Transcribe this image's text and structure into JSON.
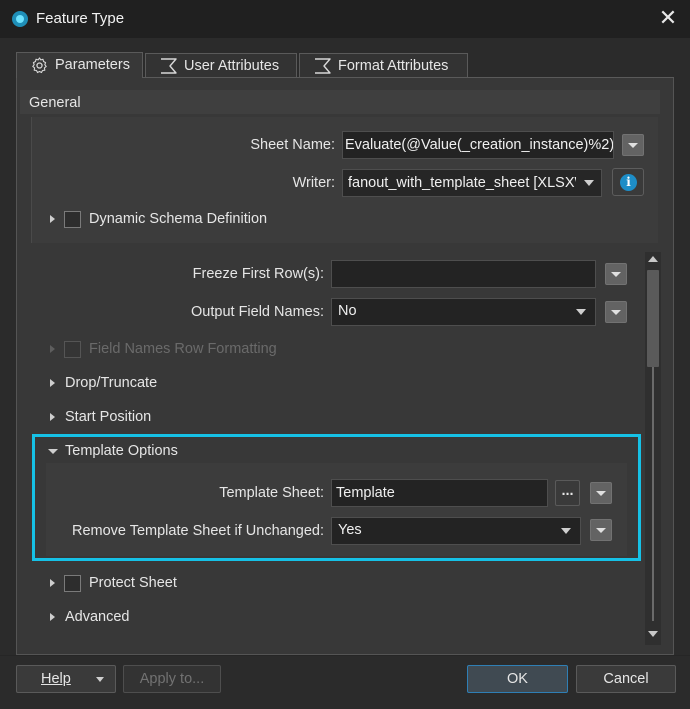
{
  "window": {
    "title": "Feature Type",
    "close_glyph": "✕"
  },
  "tabs": [
    {
      "label": "Parameters",
      "icon": "gear-icon",
      "active": true
    },
    {
      "label": "User Attributes",
      "icon": "sigma-icon",
      "active": false
    },
    {
      "label": "Format Attributes",
      "icon": "sigma-icon",
      "active": false
    }
  ],
  "general": {
    "title": "General",
    "sheet_name_label": "Sheet Name:",
    "sheet_name_value": "Evaluate(@Value(_creation_instance)%2)",
    "writer_label": "Writer:",
    "writer_value": "fanout_with_template_sheet [XLSXW]",
    "dynamic_schema_label": "Dynamic Schema Definition"
  },
  "params": {
    "freeze_label": "Freeze First Row(s):",
    "freeze_value": "",
    "output_field_names_label": "Output Field Names:",
    "output_field_names_value": "No",
    "field_names_row_formatting_label": "Field Names Row Formatting",
    "drop_truncate_label": "Drop/Truncate",
    "start_position_label": "Start Position",
    "template_options_label": "Template Options",
    "template_sheet_label": "Template Sheet:",
    "template_sheet_value": "Template",
    "browse_label": "...",
    "remove_template_label": "Remove Template Sheet if Unchanged:",
    "remove_template_value": "Yes",
    "protect_sheet_label": "Protect Sheet",
    "advanced_label": "Advanced"
  },
  "buttons": {
    "help": "Help",
    "apply_to": "Apply to...",
    "ok": "OK",
    "cancel": "Cancel"
  },
  "colors": {
    "highlight": "#16c1e6",
    "info": "#1d8dc7"
  }
}
